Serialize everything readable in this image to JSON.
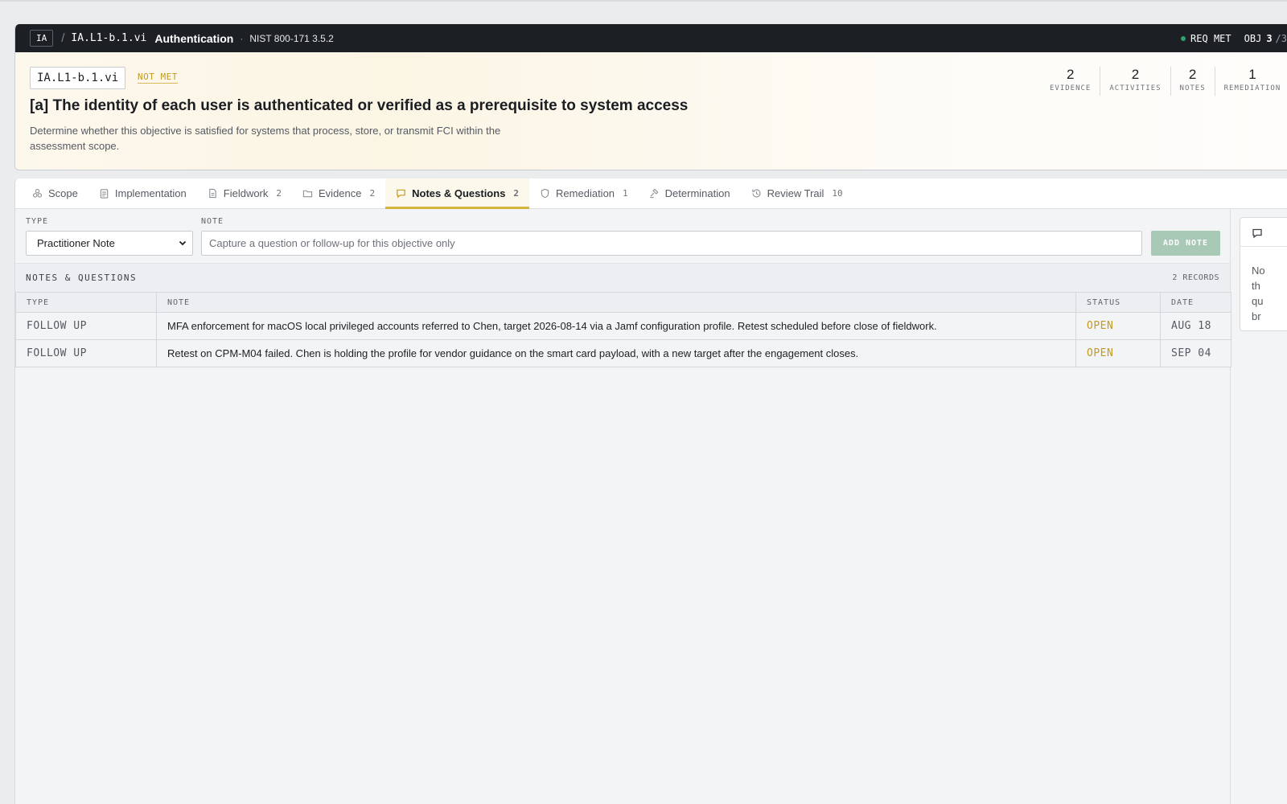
{
  "header": {
    "family_tag": "IA",
    "separator": "/",
    "objective_code": "IA.L1-b.1.vi",
    "family_title": "Authentication",
    "dot": "·",
    "reference": "NIST 800-171 3.5.2",
    "requirement_status": "REQ MET",
    "objective_label": "OBJ",
    "objective_current": "3",
    "objective_total": "/3"
  },
  "objective": {
    "code": "IA.L1-b.1.vi",
    "status": "NOT MET",
    "title": "[a] The identity of each user is authenticated or verified as a prerequisite to system access",
    "description": "Determine whether this objective is satisfied for systems that process, store, or transmit FCI within the assessment scope."
  },
  "stats": [
    {
      "value": "2",
      "label": "EVIDENCE"
    },
    {
      "value": "2",
      "label": "ACTIVITIES"
    },
    {
      "value": "2",
      "label": "NOTES"
    },
    {
      "value": "1",
      "label": "REMEDIATION"
    }
  ],
  "tabs": [
    {
      "label": "Scope",
      "count": "",
      "icon": "scope-icon"
    },
    {
      "label": "Implementation",
      "count": "",
      "icon": "clipboard-icon"
    },
    {
      "label": "Fieldwork",
      "count": "2",
      "icon": "document-icon"
    },
    {
      "label": "Evidence",
      "count": "2",
      "icon": "folder-icon"
    },
    {
      "label": "Notes & Questions",
      "count": "2",
      "icon": "chat-icon",
      "active": true
    },
    {
      "label": "Remediation",
      "count": "1",
      "icon": "shield-icon"
    },
    {
      "label": "Determination",
      "count": "",
      "icon": "gavel-icon"
    },
    {
      "label": "Review Trail",
      "count": "10",
      "icon": "history-icon"
    }
  ],
  "form": {
    "type_label": "TYPE",
    "type_value": "Practitioner Note",
    "note_label": "NOTE",
    "note_placeholder": "Capture a question or follow-up for this objective only",
    "add_button": "ADD NOTE"
  },
  "notes_section": {
    "title": "NOTES & QUESTIONS",
    "count": "2 RECORDS",
    "columns": [
      "TYPE",
      "NOTE",
      "STATUS",
      "DATE"
    ],
    "rows": [
      {
        "type": "FOLLOW UP",
        "note": "MFA enforcement for macOS local privileged accounts referred to Chen, target 2026-08-14 via a Jamf configuration profile. Retest scheduled before close of fieldwork.",
        "status": "OPEN",
        "date": "AUG 18"
      },
      {
        "type": "FOLLOW UP",
        "note": "Retest on CPM-M04 failed. Chen is holding the profile for vendor guidance on the smart card payload, with a new target after the engagement closes.",
        "status": "OPEN",
        "date": "SEP 04"
      }
    ]
  },
  "side_panel": {
    "lines": [
      "No",
      "th",
      "qu",
      "br"
    ]
  },
  "colors": {
    "accent": "#d9b43c",
    "status_warning": "#c39a1e",
    "status_ok": "#2ea36b",
    "header_bg": "#1c1f24"
  }
}
